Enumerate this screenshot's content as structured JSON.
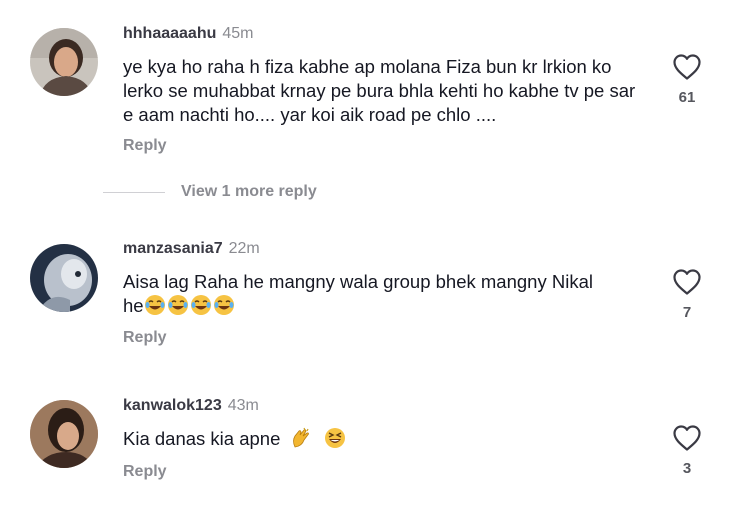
{
  "comments": [
    {
      "username": "hhhaaaaahu",
      "time": "45m",
      "text": "ye kya ho raha h fiza kabhe ap molana Fiza bun kr lrkion ko lerko se muhabbat krnay pe bura bhla kehti ho kabhe tv pe sar e aam nachti ho.... yar koi aik road pe chlo ....",
      "reply_label": "Reply",
      "likes": "61",
      "view_more_label": "View 1 more reply"
    },
    {
      "username": "manzasania7",
      "time": "22m",
      "text_line1": "Aisa lag Raha he mangny wala group bhek mangny Nikal",
      "text_line2_prefix": "he",
      "text_line2_emojis": [
        "face-with-tears-of-joy",
        "face-with-tears-of-joy",
        "face-with-tears-of-joy",
        "face-with-tears-of-joy"
      ],
      "reply_label": "Reply",
      "likes": "7"
    },
    {
      "username": "kanwalok123",
      "time": "43m",
      "text": "Kia danas kia apne",
      "text_emojis": [
        "clapping-hands",
        "grinning-squinting-face"
      ],
      "reply_label": "Reply",
      "likes": "3"
    }
  ],
  "colors": {
    "text": "#161823",
    "secondary": "#8a8b91",
    "divider": "#d0d0d4"
  },
  "icons": {
    "like": "heart-outline-icon"
  }
}
